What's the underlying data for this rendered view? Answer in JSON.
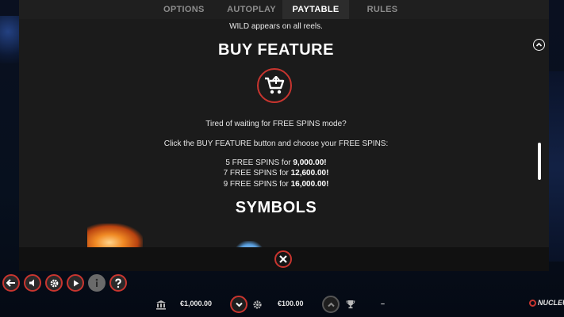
{
  "tabs": [
    "OPTIONS",
    "AUTOPLAY",
    "PAYTABLE",
    "RULES"
  ],
  "active_tab": "PAYTABLE",
  "content": {
    "intro_line": "WILD appears on all reels.",
    "buy_feature_title": "BUY FEATURE",
    "buy_text_1": "Tired of waiting for FREE SPINS mode?",
    "buy_text_2": "Click the BUY FEATURE button and choose your FREE SPINS:",
    "free_spins": [
      {
        "label": "5 FREE SPINS for ",
        "price": "9,000.00!"
      },
      {
        "label": "7 FREE SPINS for ",
        "price": "12,600.00!"
      },
      {
        "label": "9 FREE SPINS for ",
        "price": "16,000.00!"
      }
    ],
    "symbols_title": "SYMBOLS"
  },
  "bottom": {
    "balance": "€1,000.00",
    "bet": "€100.00",
    "win": "–",
    "brand": "NUCLEUS"
  },
  "icons": {
    "cart": "shopping-cart-icon",
    "close": "close-icon",
    "back": "back-arrow-icon",
    "sound": "speaker-icon",
    "settings": "gear-icon",
    "play": "play-icon",
    "info": "info-icon",
    "help": "question-icon",
    "balance": "bank-icon",
    "bet_down": "chevron-down-icon",
    "bet": "coin-icon",
    "bet_up": "chevron-up-icon",
    "win": "trophy-icon"
  },
  "colors": {
    "accent": "#c8352f",
    "panel": "#1b1b1b",
    "tab_bar": "#1f1f1f"
  }
}
